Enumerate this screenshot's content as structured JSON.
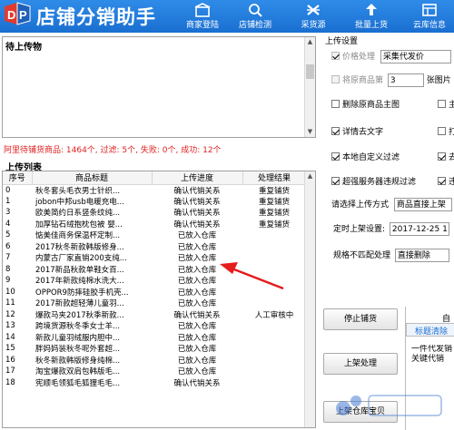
{
  "app": {
    "title": "店铺分销助手"
  },
  "nav": [
    {
      "label": "商家登陆",
      "icon": "store-login-icon"
    },
    {
      "label": "店铺检测",
      "icon": "shop-check-icon"
    },
    {
      "label": "采货源",
      "icon": "source-goods-icon"
    },
    {
      "label": "批量上货",
      "icon": "bulk-upload-icon"
    },
    {
      "label": "云库信息",
      "icon": "cloud-library-icon"
    }
  ],
  "pending": {
    "title": "待上传物"
  },
  "stats": {
    "text": "阿里待铺货商品: 1464个, 过滤: 5个, 失败: 0个, 成功: 12个"
  },
  "upload_list": {
    "title": "上传列表",
    "columns": [
      "序号",
      "商品标题",
      "上传进度",
      "处理结果"
    ],
    "rows": [
      [
        "0",
        "秋冬套头毛衣男士针织...",
        "确认代销关系",
        "重复铺货"
      ],
      [
        "1",
        "jobon中邦usb电暖充电...",
        "确认代销关系",
        "重复铺货"
      ],
      [
        "3",
        "欧美简约日系竖条纹纯...",
        "确认代销关系",
        "重复铺货"
      ],
      [
        "4",
        "加厚钻石绒抱枕包被 婴...",
        "确认代销关系",
        "重复铺货"
      ],
      [
        "5",
        "惦美佳商务保温杯定制...",
        "已放入仓库",
        ""
      ],
      [
        "6",
        "2017秋冬新款韩版修身...",
        "已放入仓库",
        ""
      ],
      [
        "7",
        "内蒙古厂家直销200支纯...",
        "已放入仓库",
        ""
      ],
      [
        "8",
        "2017新品秋款单鞋女百...",
        "已放入仓库",
        ""
      ],
      [
        "9",
        "2017年新款纯棉水洗大...",
        "已放入仓库",
        ""
      ],
      [
        "10",
        "OPPOR9防摔硅胶手机壳...",
        "已放入仓库",
        ""
      ],
      [
        "11",
        "2017新款超轻薄儿童羽...",
        "已放入仓库",
        ""
      ],
      [
        "12",
        "爆款马夹2017秋季新款...",
        "确认代销关系",
        "人工审核中"
      ],
      [
        "13",
        "跨境货源秋冬季女士羊...",
        "已放入仓库",
        ""
      ],
      [
        "14",
        "新款儿童羽绒服内胆中...",
        "已放入仓库",
        ""
      ],
      [
        "15",
        "胖妈妈装秋冬呢外套超...",
        "已放入仓库",
        ""
      ],
      [
        "16",
        "秋冬新款韩版修身纯棉...",
        "已放入仓库",
        ""
      ],
      [
        "17",
        "淘宝爆款双肩包韩版毛...",
        "已放入仓库",
        ""
      ],
      [
        "18",
        "宪顺毛领狐毛狐狸毛毛...",
        "确认代销关系",
        ""
      ]
    ]
  },
  "settings": {
    "group": "上传设置",
    "price_label": "价格处理",
    "price_value": "采集代发价",
    "first_image_label": "将原商品第",
    "first_image_num": "3",
    "first_image_suffix": "张图片",
    "delete_main_image": "删除原商品主图",
    "detail_text": "详情去文字",
    "local_filter": "本地自定义过滤",
    "server_filter": "超强服务器违规过滤",
    "upload_mode_label": "请选择上传方式",
    "upload_mode_value": "商品直接上架",
    "schedule_label": "定时上架设置:",
    "schedule_value": "2017-12-25 11",
    "spec_label": "规格不匹配处理",
    "spec_value": "直接删除",
    "cut_chk_a": "主",
    "cut_chk_b": "打",
    "cut_chk_c": "去",
    "cut_chk_d": "违"
  },
  "buttons": {
    "stop": "停止铺货",
    "listing": "上架处理",
    "listing_warehouse": "上架仓库宝贝"
  },
  "side_tab": {
    "top": "自",
    "strip": "标题清除",
    "body": "一件代发销关键代销"
  },
  "colors": {
    "header": "#1a6fd0",
    "stats": "#e02020",
    "arrow": "#e51c1c"
  }
}
